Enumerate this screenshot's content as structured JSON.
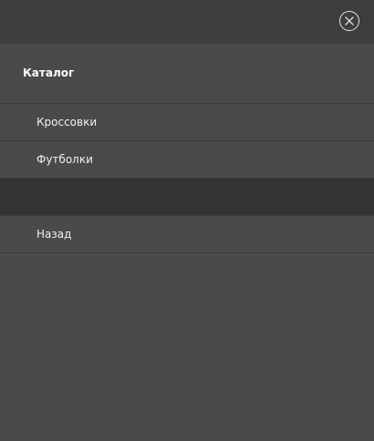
{
  "menu": {
    "title": "Каталог",
    "items": [
      {
        "label": "Кроссовки"
      },
      {
        "label": "Футболки"
      },
      {
        "label": ""
      },
      {
        "label": "Назад"
      }
    ]
  },
  "icons": {
    "close": "close-icon"
  },
  "colors": {
    "background": "#4a4a4a",
    "topbar": "#3d3d3d",
    "active_item": "#333333",
    "text": "#ffffff"
  }
}
